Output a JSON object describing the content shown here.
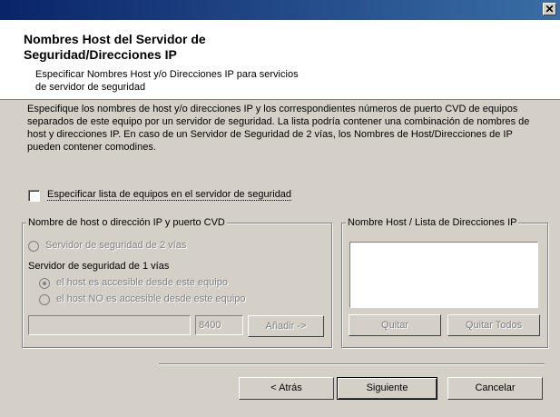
{
  "window": {
    "close_glyph": "✕"
  },
  "header": {
    "title": "Nombres Host del Servidor de Seguridad/Direcciones IP",
    "subtitle": "Especificar Nombres Host y/o Direcciones IP para servicios de servidor de seguridad"
  },
  "description": "Especifique los nombres de host y/o direcciones IP y los correspondientes números de puerto CVD de equipos separados de este equipo por un servidor de seguridad. La lista podría contener una combinación de nombres de host y direcciones IP. En caso de un Servidor de Seguridad de 2 vías, los Nombres de Host/Direcciones de IP pueden contener comodines.",
  "specify_checkbox": {
    "label": "Especificar lista de equipos en el servidor de seguridad",
    "checked": false
  },
  "host_group": {
    "label": "Nombre de host o dirección IP y puerto CVD",
    "radio_2way": "Servidor de seguridad de 2 vías",
    "label_1way": "Servidor de seguridad de 1 vías",
    "radio_accessible": "el host es accesible desde este equipo",
    "radio_not_accessible": "el host NO es accesible desde este equipo",
    "host_value": "",
    "port_value": "8400",
    "add_button": "Añadir ->"
  },
  "list_group": {
    "label": "Nombre Host / Lista de Direcciones IP",
    "items": [],
    "remove_button": "Quitar",
    "remove_all_button": "Quitar Todos"
  },
  "footer": {
    "back_button": "< Atrás",
    "next_button": "Siguiente",
    "cancel_button": "Cancelar"
  }
}
